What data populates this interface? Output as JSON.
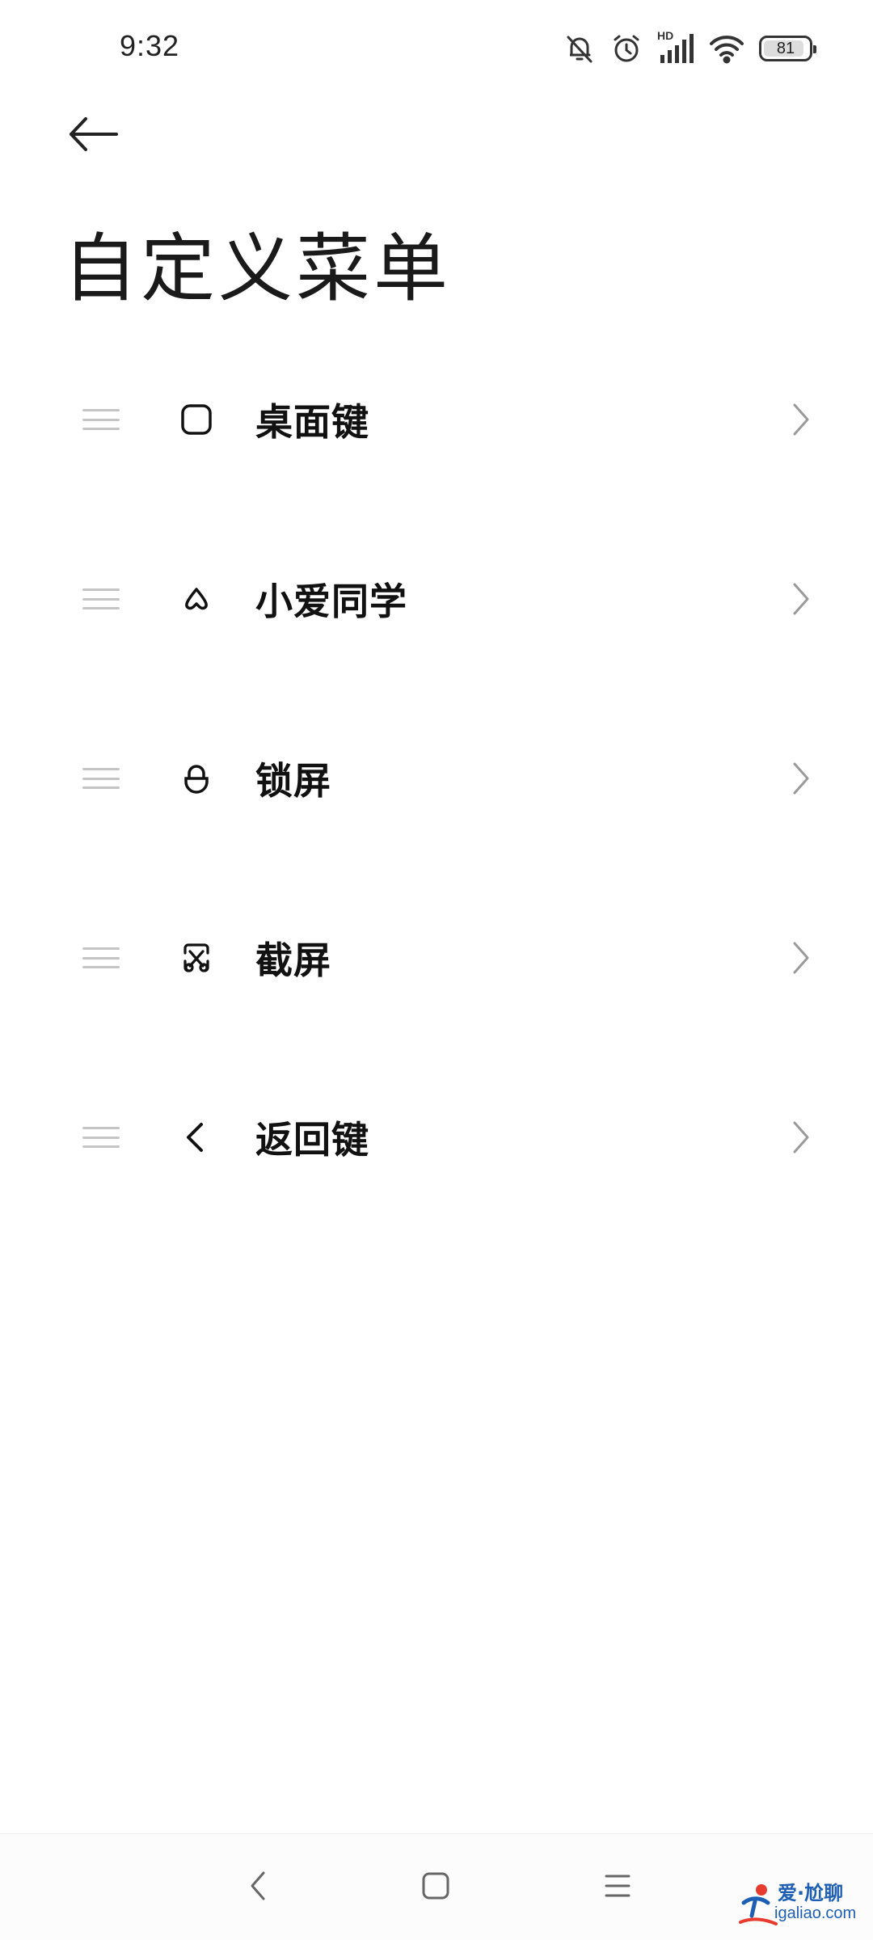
{
  "status_bar": {
    "time": "9:32",
    "icons": [
      "mute-bell-icon",
      "alarm-icon",
      "hd-signal-icon",
      "wifi-icon",
      "battery-icon"
    ],
    "hd_label": "HD",
    "battery_level": "81"
  },
  "header": {
    "back_icon": "arrow-left-icon",
    "title": "自定义菜单"
  },
  "menu_items": [
    {
      "label": "桌面键",
      "icon": "home-square-icon"
    },
    {
      "label": "小爱同学",
      "icon": "xiaoai-assistant-icon"
    },
    {
      "label": "锁屏",
      "icon": "lock-icon"
    },
    {
      "label": "截屏",
      "icon": "screenshot-scissors-icon"
    },
    {
      "label": "返回键",
      "icon": "back-chevron-icon"
    }
  ],
  "nav_bar": {
    "buttons": [
      "nav-back-icon",
      "nav-home-icon",
      "nav-recents-icon"
    ]
  },
  "watermark": {
    "title": "爱·尬聊",
    "url": "igaliao.com"
  },
  "colors": {
    "text": "#111111",
    "drag_handle": "#c4c4c4",
    "chevron": "#9a9a9a",
    "watermark": "#1e5fb4"
  }
}
